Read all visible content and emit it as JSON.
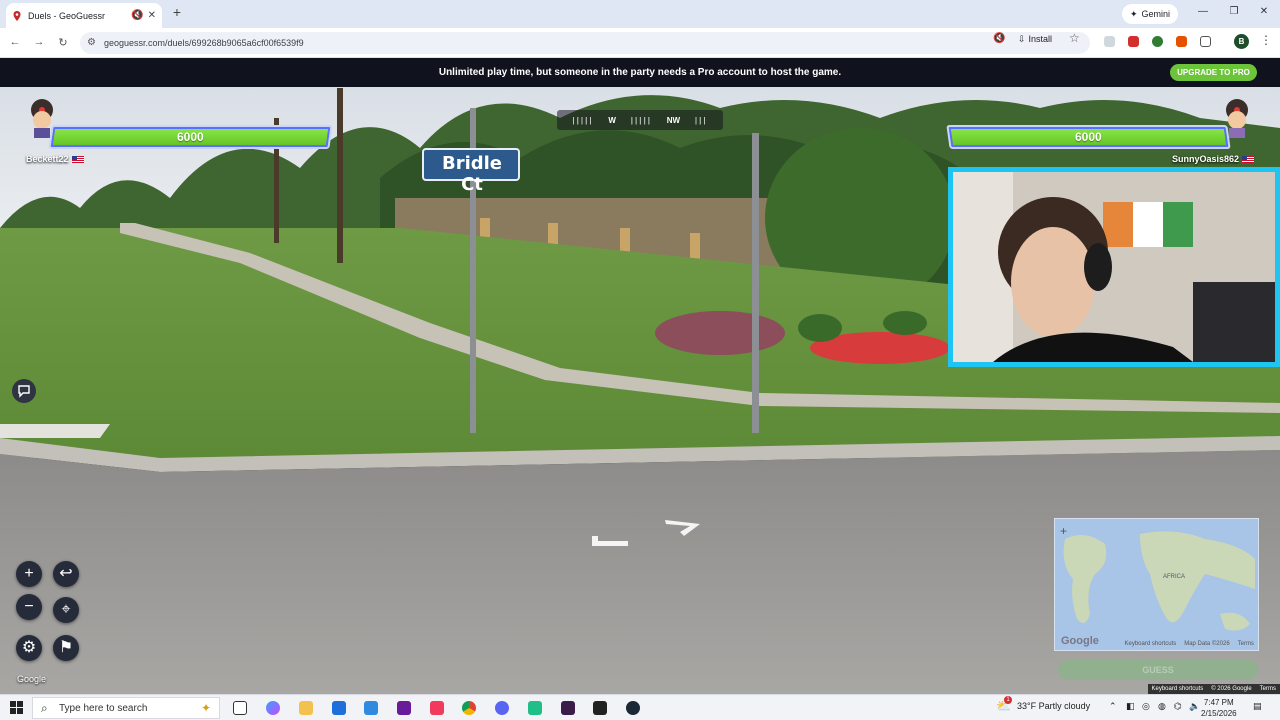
{
  "browser": {
    "tab_title": "Duels - GeoGuessr",
    "url": "geoguessr.com/duels/699268b9065a6cf00f6539f9",
    "install_label": "Install",
    "gemini_label": "Gemini",
    "profile_initial": "B"
  },
  "game": {
    "promo_text": "Unlimited play time, but someone in the party needs a Pro account to host the game.",
    "upgrade_label": "UPGRADE TO PRO",
    "player_left": {
      "name": "Beckett22",
      "health": "6000"
    },
    "player_right": {
      "name": "SunnyOasis862",
      "health": "6000"
    },
    "compass": {
      "w": "W",
      "nw": "NW"
    },
    "street_sign": "Bridle Ct",
    "minimap": {
      "africa_label": "AFRICA",
      "google_label": "Google",
      "footer": [
        "Keyboard shortcuts",
        "Map Data ©2026",
        "Terms"
      ]
    },
    "guess_label": "GUESS",
    "google_label": "Google",
    "sv_footer": [
      "Keyboard shortcuts",
      "© 2026 Google",
      "Terms"
    ],
    "controls": {
      "zoom_in": "+",
      "zoom_out": "−",
      "back": "↩",
      "settings": "⚙",
      "checkpoint": "⚑",
      "location": "⌖"
    }
  },
  "taskbar": {
    "search_placeholder": "Type here to search",
    "weather": "33°F  Partly cloudy",
    "time": "7:47 PM",
    "date": "2/15/2026",
    "weather_badge": "1"
  },
  "colors": {
    "health_green": "#6cc43a",
    "webcam_border": "#1ec5f2",
    "promo_bg": "#10121e"
  }
}
